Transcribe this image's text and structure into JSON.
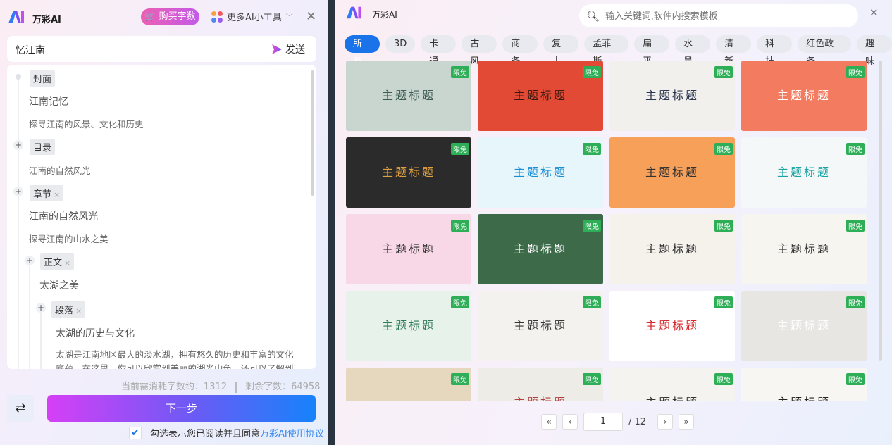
{
  "left": {
    "brand": "万彩AI",
    "buy_label": "购买字数",
    "tools_label": "更多AI小工具",
    "input_value": "忆江南",
    "send_label": "发送",
    "tree": {
      "cover_tag": "封面",
      "cover_title": "江南记忆",
      "cover_subtitle": "探寻江南的风景、文化和历史",
      "toc_tag": "目录",
      "toc_item": "江南的自然风光",
      "chapter_tag": "章节",
      "chapter_title": "江南的自然风光",
      "chapter_subtitle": "探寻江南的山水之美",
      "body_tag": "正文",
      "body_title": "太湖之美",
      "para_tag": "段落",
      "para_title": "太湖的历史与文化",
      "para_text": "太湖是江南地区最大的淡水湖，拥有悠久的历史和丰富的文化底蕴。在这里，你可以欣赏到美丽的湖光山色，还可以了解到太湖的"
    },
    "usage_label": "当前需消耗字数约：1312",
    "remaining_label": "剩余字数：64958",
    "next_label": "下一步",
    "agree_text": "勾选表示您已阅读并且同意",
    "agree_link": "万彩AI使用协议",
    "agree_checked": true
  },
  "right": {
    "brand": "万彩AI",
    "search_placeholder": "输入关键词,软件内搜索模板",
    "categories": [
      "所有",
      "3D",
      "卡通",
      "古风",
      "商务",
      "复古",
      "孟菲斯",
      "扁平",
      "水墨",
      "清新",
      "科技",
      "红色政务",
      "趣味"
    ],
    "active_category": "所有",
    "badge": "限免",
    "cards": [
      {
        "title": "主题标题",
        "bg": "#c9d6cf",
        "fg": "#3d5a55"
      },
      {
        "title": "主题标题",
        "bg": "#e24a36",
        "fg": "#3a1a10"
      },
      {
        "title": "主题标题",
        "bg": "#f2f0ec",
        "fg": "#2a3550"
      },
      {
        "title": "主题标题",
        "bg": "#f27b60",
        "fg": "#ffffff"
      },
      {
        "title": "主题标题",
        "bg": "#2b2b2b",
        "fg": "#e0a040"
      },
      {
        "title": "主题标题",
        "bg": "#e6f6fb",
        "fg": "#1b8fd6"
      },
      {
        "title": "主题标题",
        "bg": "#f6a05a",
        "fg": "#333333"
      },
      {
        "title": "主题标题",
        "bg": "#f4f8f8",
        "fg": "#1aa3a3"
      },
      {
        "title": "主题标题",
        "bg": "#f8d8e6",
        "fg": "#333333"
      },
      {
        "title": "主题标题",
        "bg": "#3d6b4a",
        "fg": "#ffffff"
      },
      {
        "title": "主题标题",
        "bg": "#f5f2ec",
        "fg": "#333333"
      },
      {
        "title": "主题标题",
        "bg": "#f7f5f0",
        "fg": "#333333"
      },
      {
        "title": "主题标题",
        "bg": "#e6f2ea",
        "fg": "#2e7a55"
      },
      {
        "title": "主题标题",
        "bg": "#f4f2ef",
        "fg": "#333333"
      },
      {
        "title": "主题标题",
        "bg": "#ffffff",
        "fg": "#d8262a"
      },
      {
        "title": "主题标题",
        "bg": "#e8e6e3",
        "fg": "#ffffff"
      },
      {
        "title": "",
        "bg": "#e6d8bf",
        "fg": "#333333"
      },
      {
        "title": "主题标题",
        "bg": "#eeece6",
        "fg": "#b04040"
      },
      {
        "title": "主题标题",
        "bg": "#f5f3ef",
        "fg": "#333333"
      },
      {
        "title": "主题标题",
        "bg": "#f8f6f3",
        "fg": "#222222"
      }
    ],
    "pager": {
      "current": "1",
      "total": "/ 12"
    }
  }
}
